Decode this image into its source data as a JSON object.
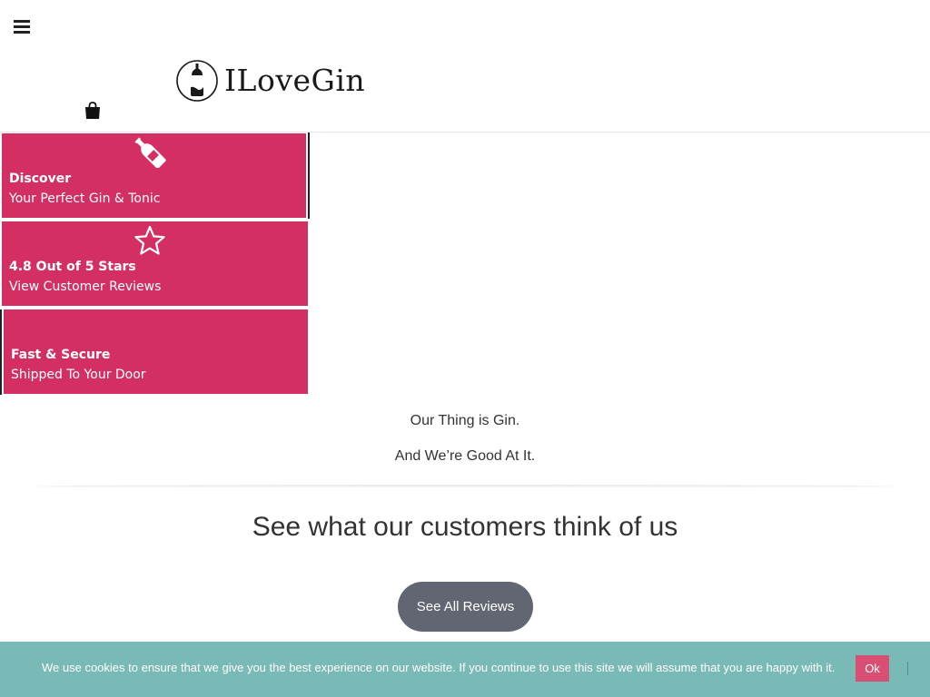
{
  "header": {
    "menu_icon": "hamburger-icon",
    "logo_text": "ILoveGin",
    "cart_icon": "shopping-bag-icon"
  },
  "features": [
    {
      "icon": "bottle-icon",
      "title": "Discover",
      "subtitle": "Your Perfect Gin & Tonic"
    },
    {
      "icon": "star-icon",
      "title": "4.8 Out of 5 Stars",
      "subtitle": "View Customer Reviews"
    },
    {
      "icon": "",
      "title": "Fast & Secure",
      "subtitle": "Shipped To Your Door"
    }
  ],
  "tagline": {
    "line1": "Our Thing is Gin.",
    "line2": "And We’re Good At It."
  },
  "reviews": {
    "heading": "See what our customers think of us",
    "button_label": "See All Reviews"
  },
  "cookie_banner": {
    "text": "We use cookies to ensure that we give you the best experience on our website. If you continue to use this site we will assume that you are happy with it.",
    "ok_label": "Ok"
  },
  "colors": {
    "tile_bg": "#d32f63",
    "button_bg": "#626672",
    "cookie_bg": "#79b9b6",
    "cookie_ok_bg": "#d94f73"
  }
}
